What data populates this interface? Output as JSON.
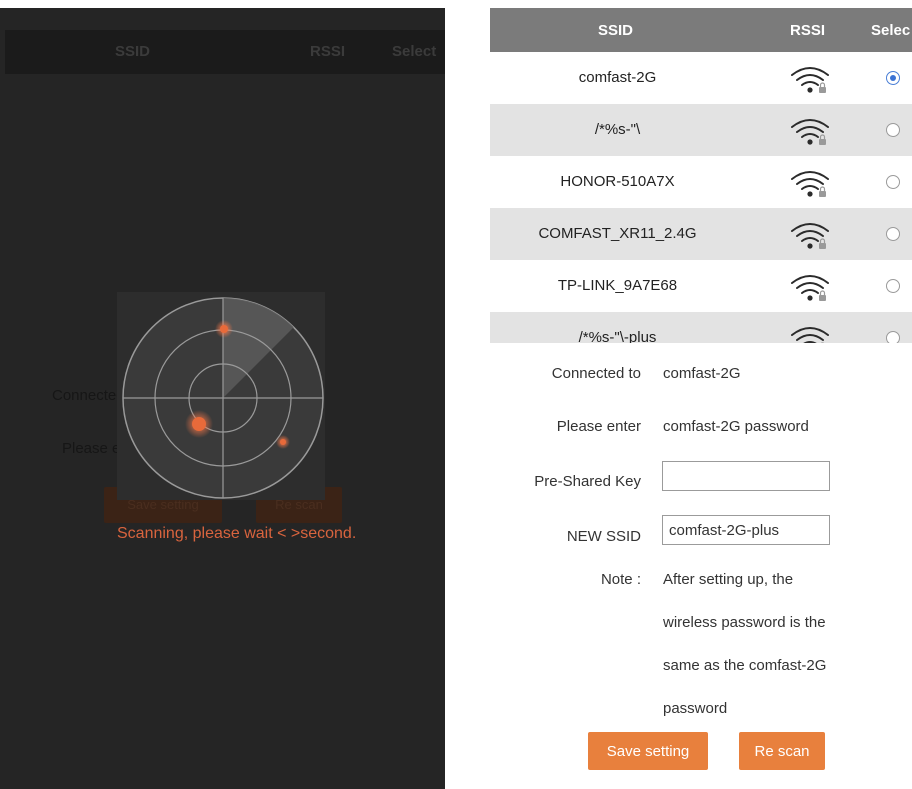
{
  "colors": {
    "accent": "#e8803d",
    "table_header": "#7b7b7b",
    "row_alt": "#e3e3e3",
    "overlay": "#252525",
    "scan_text": "#d9643e",
    "radio_checked": "#3b73d4"
  },
  "table": {
    "headers": {
      "ssid": "SSID",
      "rssi": "RSSI",
      "select": "Selec"
    },
    "rows": [
      {
        "ssid": "comfast-2G",
        "signal_icon": "wifi-locked-icon",
        "selected": true
      },
      {
        "ssid": "/*%s-\"\\",
        "signal_icon": "wifi-locked-icon",
        "selected": false
      },
      {
        "ssid": "HONOR-510A7X",
        "signal_icon": "wifi-locked-icon",
        "selected": false
      },
      {
        "ssid": "COMFAST_XR11_2.4G",
        "signal_icon": "wifi-locked-icon",
        "selected": false
      },
      {
        "ssid": "TP-LINK_9A7E68",
        "signal_icon": "wifi-locked-icon",
        "selected": false
      },
      {
        "ssid": "/*%s-\"\\-plus",
        "signal_icon": "wifi-locked-icon",
        "selected": false
      }
    ]
  },
  "form": {
    "connected_label": "Connected to",
    "connected_value": "comfast-2G",
    "enter_label": "Please enter",
    "enter_value": "comfast-2G password",
    "psk_label": "Pre-Shared Key",
    "psk_value": "",
    "new_ssid_label": "NEW SSID",
    "new_ssid_value": "comfast-2G-plus",
    "note_label": "Note :",
    "note_lines": [
      "After setting up, the",
      "wireless password is the",
      "same as the comfast-2G",
      "password"
    ]
  },
  "buttons": {
    "save": "Save setting",
    "rescan": "Re scan"
  },
  "scanning": {
    "message": "Scanning, please wait < >second.",
    "background_header": {
      "ssid": "SSID",
      "rssi": "RSSI",
      "select": "Select"
    },
    "background_labels": {
      "connected": "Connected t",
      "enter": "Please ent"
    },
    "background_buttons": {
      "save": "Save setting",
      "rescan": "Re scan"
    }
  }
}
